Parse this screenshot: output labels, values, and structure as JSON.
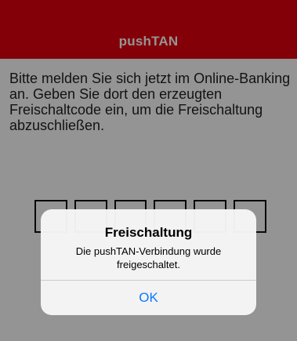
{
  "header": {
    "title": "pushTAN",
    "accent_color": "#e3000f"
  },
  "instruction": {
    "text": "Bitte melden Sie sich jetzt im Online-Banking an. Geben Sie dort den erzeugten Freischaltcode ein, um die Freischaltung abzuschließen."
  },
  "code_fields": {
    "count": 6
  },
  "alert": {
    "title": "Freischaltung",
    "message": "Die pushTAN-Verbindung wurde freigeschaltet.",
    "ok_label": "OK",
    "button_color": "#0a7aff"
  }
}
